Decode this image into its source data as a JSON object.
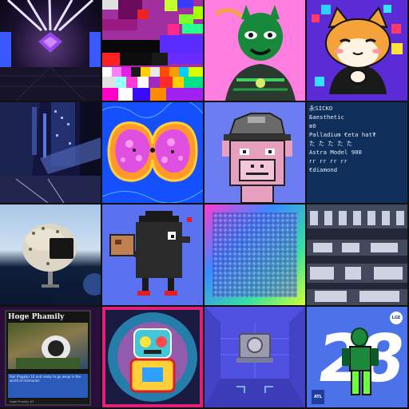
{
  "gallery": {
    "text_tile": {
      "lines": [
        "永SICKO",
        "Бaesthetic",
        "вб",
        "Palladium €eta hat₮",
        "た た た た た",
        "Astra Model 900",
        "гг гг гг гг",
        "€diamond"
      ]
    },
    "card_tile": {
      "title": "Hoge Phamily",
      "body": "Roll (Pupply) 10 and ready to go away in the world of memories",
      "footer": "Hoge Phamily #5"
    },
    "sport_tile": {
      "number": "28",
      "top_badge": "LGE",
      "team": "ATL"
    }
  }
}
